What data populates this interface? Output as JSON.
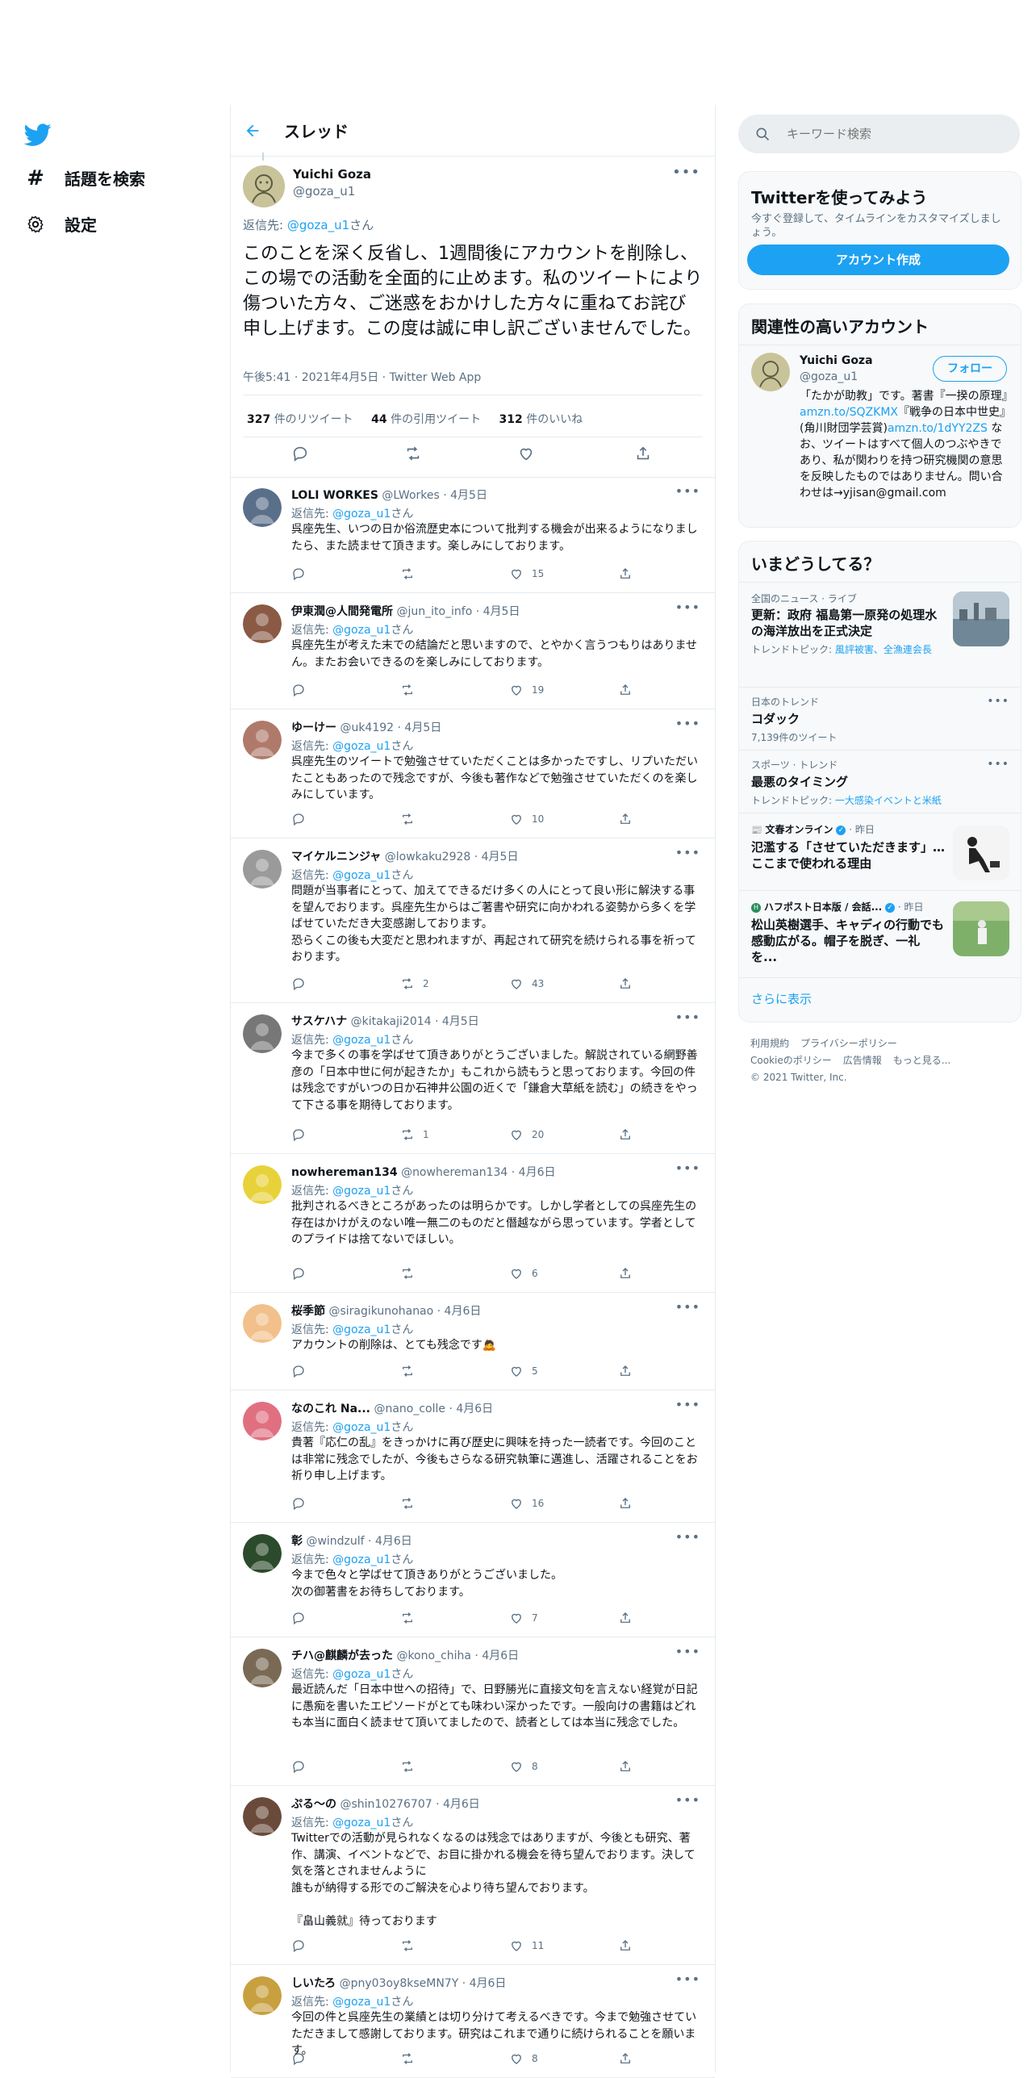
{
  "nav": {
    "explore": "話題を検索",
    "settings": "設定"
  },
  "header": {
    "title": "スレッド"
  },
  "main_tweet": {
    "name": "Yuichi Goza",
    "handle": "@goza_u1",
    "reply_prefix": "返信先: ",
    "reply_to": "@goza_u1",
    "reply_suffix": "さん",
    "text": "このことを深く反省し、1週間後にアカウントを削除し、この場での活動を全面的に止めます。私のツイートにより傷ついた方々、ご迷惑をおかけした方々に重ねてお詫び申し上げます。この度は誠に申し訳ございませんでした。",
    "meta": "午後5:41 · 2021年4月5日 · Twitter Web App",
    "retweets": "327",
    "retweets_label": "件のリツイート",
    "quotes": "44",
    "quotes_label": "件の引用ツイート",
    "likes": "312",
    "likes_label": "件のいいね"
  },
  "replies": [
    {
      "name": "LOLI WORKES",
      "handle": "@LWorkes · 4月5日",
      "reply_to": "@goza_u1",
      "suffix": "さん",
      "text": "呉座先生、いつの日か俗流歴史本について批判する機会が出来るようになりましたら、また読ませて頂きます。楽しみにしております。",
      "retweets": "",
      "likes": "15",
      "avatar_color": "#5a6f8a"
    },
    {
      "name": "伊東潤@人間発電所",
      "handle": "@jun_ito_info · 4月5日",
      "reply_to": "@goza_u1",
      "suffix": "さん",
      "text": "呉座先生が考えた末での結論だと思いますので、とやかく言うつもりはありません。またお会いできるのを楽しみにしております。",
      "retweets": "",
      "likes": "19",
      "avatar_color": "#8a5a45"
    },
    {
      "name": "ゆーけー",
      "handle": "@uk4192 · 4月5日",
      "reply_to": "@goza_u1",
      "suffix": "さん",
      "text": "呉座先生のツイートで勉強させていただくことは多かったですし、リプいただいたこともあったので残念ですが、今後も著作などで勉強させていただくのを楽しみにしています。",
      "retweets": "",
      "likes": "10",
      "avatar_color": "#b07a6a"
    },
    {
      "name": "マイケルニンジャ",
      "handle": "@lowkaku2928 · 4月5日",
      "reply_to": "@goza_u1",
      "suffix": "さん",
      "text": "問題が当事者にとって、加えてできるだけ多くの人にとって良い形に解決する事を望んでおります。呉座先生からはご著書や研究に向かわれる姿勢から多くを学ばせていただき大変感謝しております。\n恐らくこの後も大変だと思われますが、再起されて研究を続けられる事を祈っております。",
      "retweets": "2",
      "likes": "43",
      "avatar_color": "#9a9a9a"
    },
    {
      "name": "サスケハナ",
      "handle": "@kitakaji2014 · 4月5日",
      "reply_to": "@goza_u1",
      "suffix": "さん",
      "text": "今まで多くの事を学ばせて頂きありがとうございました。解説されている網野善彦の「日本中世に何が起きたか」もこれから読もうと思っております。今回の件は残念ですがいつの日か石神井公園の近くで「鎌倉大草紙を読む」の続きをやって下さる事を期待しております。",
      "retweets": "1",
      "likes": "20",
      "avatar_color": "#777777"
    },
    {
      "name": "nowhereman134",
      "handle": "@nowhereman134 · 4月6日",
      "reply_to": "@goza_u1",
      "suffix": "さん",
      "text": "批判されるべきところがあったのは明らかです。しかし学者としての呉座先生の存在はかけがえのない唯一無二のものだと僭越ながら思っています。学者としてのプライドは捨てないでほしい。",
      "retweets": "",
      "likes": "6",
      "avatar_color": "#e8d23a"
    },
    {
      "name": "桜季節",
      "handle": "@siragikunohanao · 4月6日",
      "reply_to": "@goza_u1",
      "suffix": "さん",
      "text": "アカウントの削除は、とても残念です🙇",
      "retweets": "",
      "likes": "5",
      "avatar_color": "#f2c08a"
    },
    {
      "name": "なのこれ Na...",
      "handle": "@nano_colle · 4月6日",
      "reply_to": "@goza_u1",
      "suffix": "さん",
      "text": "貴著『応仁の乱』をきっかけに再び歴史に興味を持った一読者です。今回のことは非常に残念でしたが、今後もさらなる研究執筆に邁進し、活躍されることをお祈り申し上げます。",
      "retweets": "",
      "likes": "16",
      "avatar_color": "#e07080"
    },
    {
      "name": "彰",
      "handle": "@windzulf · 4月6日",
      "reply_to": "@goza_u1",
      "suffix": "さん",
      "text": "今まで色々と学ばせて頂きありがとうございました。\n次の御著書をお待ちしております。",
      "retweets": "",
      "likes": "7",
      "avatar_color": "#2c4a2c"
    },
    {
      "name": "チハ@麒麟が去った",
      "handle": "@kono_chiha · 4月6日",
      "reply_to": "@goza_u1",
      "suffix": "さん",
      "text": "最近読んだ「日本中世への招待」で、日野勝光に直接文句を言えない経覚が日記に愚痴を書いたエピソードがとても味わい深かったです。一般向けの書籍はどれも本当に面白く読ませて頂いてましたので、読者としては本当に残念でした。",
      "retweets": "",
      "likes": "8",
      "avatar_color": "#7a6a55"
    },
    {
      "name": "ぷる〜の",
      "handle": "@shin10276707 · 4月6日",
      "reply_to": "@goza_u1",
      "suffix": "さん",
      "text": "Twitterでの活動が見られなくなるのは残念ではありますが、今後とも研究、著作、講演、イベントなどで、お目に掛かれる機会を待ち望んでおります。決して気を落とされませんように\n誰もが納得する形でのご解決を心より待ち望んでおります。\n\n『畠山義就』待っております",
      "retweets": "",
      "likes": "11",
      "avatar_color": "#6a4a3a"
    },
    {
      "name": "しいたろ",
      "handle": "@pny03oy8kseMN7Y · 4月6日",
      "reply_to": "@goza_u1",
      "suffix": "さん",
      "text": "今回の件と呉座先生の業績とは切り分けて考えるべきです。今まで勉強させていただきまして感謝しております。研究はこれまで通りに続けられることを願います。",
      "retweets": "",
      "likes": "8",
      "avatar_color": "#c8a040"
    }
  ],
  "search": {
    "placeholder": "キーワード検索"
  },
  "signup": {
    "title": "Twitterを使ってみよう",
    "desc": "今すぐ登録して、タイムラインをカスタマイズしましょう。",
    "button": "アカウント作成"
  },
  "relevant": {
    "title": "関連性の高いアカウント",
    "name": "Yuichi Goza",
    "handle": "@goza_u1",
    "follow": "フォロー",
    "bio_1": "「たかが助教」です。著書『一揆の原理』",
    "link_1": "amzn.to/SQZKMX",
    "bio_2": "『戦争の日本中世史』(角川財団学芸賞)",
    "link_2": "amzn.to/1dYY2ZS",
    "bio_3": " なお、ツイートはすべて個人のつぶやきであり、私が関わりを持つ研究機関の意思を反映したものではありません。問い合わせは→yjisan@gmail.com"
  },
  "trends": {
    "title": "いまどうしてる？",
    "items": [
      {
        "meta": "全国のニュース · ライブ",
        "title": "更新：政府 福島第一原発の処理水の海洋放出を正式決定",
        "topic_label": "トレンドトピック: ",
        "topic": "風評被害、全漁連会長"
      },
      {
        "meta": "日本のトレンド",
        "title": "コダック",
        "count": "7,139件のツイート"
      },
      {
        "meta": "スポーツ · トレンド",
        "title": "最悪のタイミング",
        "topic_label": "トレンドトピック: ",
        "topic": "一大感染イベントと米紙"
      },
      {
        "meta_source": "文春オンライン",
        "meta_time": " · 昨日",
        "title": "氾濫する「させていただきます」…ここまで使われる理由"
      },
      {
        "meta_source": "ハフポスト日本版 / 会話...",
        "meta_time": " · 昨日",
        "title": "松山英樹選手、キャディの行動でも感動広がる。帽子を脱ぎ、一礼を..."
      }
    ],
    "show_more": "さらに表示"
  },
  "footer": {
    "terms": "利用規約",
    "privacy": "プライバシーポリシー",
    "cookie": "Cookieのポリシー",
    "ads": "広告情報",
    "more": "もっと見る...",
    "copyright": "© 2021 Twitter, Inc."
  },
  "colors": {
    "accent": "#1da1f2",
    "secondary_text": "#5b7083",
    "border": "#e6ecf0"
  }
}
